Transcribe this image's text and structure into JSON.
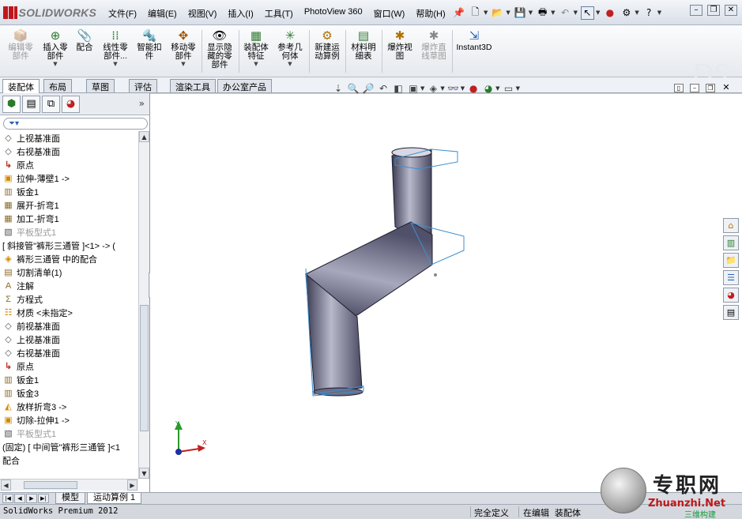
{
  "app": {
    "logo_text": "SOLIDWORKS"
  },
  "menu": [
    "文件(F)",
    "编辑(E)",
    "视图(V)",
    "插入(I)",
    "工具(T)",
    "PhotoView 360",
    "窗口(W)",
    "帮助(H)"
  ],
  "commands": [
    {
      "label": "编辑零\n部件",
      "icon": "edit-component-icon",
      "disabled": true,
      "arrow": false
    },
    {
      "label": "插入零\n部件",
      "icon": "insert-components-icon",
      "disabled": false,
      "arrow": true
    },
    {
      "label": "配合",
      "icon": "mate-icon",
      "disabled": false,
      "arrow": false
    },
    {
      "label": "线性零\n部件...",
      "icon": "linear-pattern-icon",
      "disabled": false,
      "arrow": true
    },
    {
      "label": "智能扣\n件",
      "icon": "smart-fasteners-icon",
      "disabled": false,
      "arrow": false
    },
    {
      "label": "移动零\n部件",
      "icon": "move-component-icon",
      "disabled": false,
      "arrow": true
    },
    {
      "label": "显示隐\n藏的零\n部件",
      "icon": "show-hidden-icon",
      "disabled": false,
      "arrow": false
    },
    {
      "label": "装配体\n特征",
      "icon": "assembly-features-icon",
      "disabled": false,
      "arrow": true
    },
    {
      "label": "参考几\n何体",
      "icon": "reference-geometry-icon",
      "disabled": false,
      "arrow": true
    },
    {
      "label": "新建运\n动算例",
      "icon": "new-motion-study-icon",
      "disabled": false,
      "arrow": false
    },
    {
      "label": "材料明\n细表",
      "icon": "bill-of-materials-icon",
      "disabled": false,
      "arrow": false
    },
    {
      "label": "爆炸视\n图",
      "icon": "exploded-view-icon",
      "disabled": false,
      "arrow": false
    },
    {
      "label": "爆炸直\n线草图",
      "icon": "explode-line-sketch-icon",
      "disabled": true,
      "arrow": false
    },
    {
      "label": "Instant3D",
      "icon": "instant3d-icon",
      "disabled": false,
      "arrow": false
    }
  ],
  "cm_tabs": [
    "装配体",
    "布局",
    "草图",
    "评估",
    "渲染工具",
    "办公室产品"
  ],
  "tree": [
    {
      "text": "上视基准面",
      "icon": "plane-icon",
      "dim": false
    },
    {
      "text": "右视基准面",
      "icon": "plane-icon",
      "dim": false
    },
    {
      "text": "原点",
      "icon": "origin-icon",
      "dim": false
    },
    {
      "text": "拉伸-薄壁1 ->",
      "icon": "extrude-icon",
      "dim": false
    },
    {
      "text": "钣金1",
      "icon": "sheet-metal-icon",
      "dim": false
    },
    {
      "text": "展开-折弯1",
      "icon": "unfold-icon",
      "dim": false
    },
    {
      "text": "加工-折弯1",
      "icon": "process-bend-icon",
      "dim": false
    },
    {
      "text": "平板型式1",
      "icon": "flat-pattern-icon",
      "dim": true
    },
    {
      "text": "[ 斜接管\"裤形三通管 ]<1> -> (",
      "icon": "",
      "dim": false
    },
    {
      "text": "裤形三通管 中的配合",
      "icon": "mates-folder-icon",
      "dim": false
    },
    {
      "text": "切割清单(1)",
      "icon": "cut-list-icon",
      "dim": false
    },
    {
      "text": "注解",
      "icon": "annotations-icon",
      "dim": false
    },
    {
      "text": "方程式",
      "icon": "equations-icon",
      "dim": false
    },
    {
      "text": "材质 <未指定>",
      "icon": "material-icon",
      "dim": false
    },
    {
      "text": "前视基准面",
      "icon": "plane-icon",
      "dim": false
    },
    {
      "text": "上视基准面",
      "icon": "plane-icon",
      "dim": false
    },
    {
      "text": "右视基准面",
      "icon": "plane-icon",
      "dim": false
    },
    {
      "text": "原点",
      "icon": "origin-icon",
      "dim": false
    },
    {
      "text": "钣金1",
      "icon": "sheet-metal-icon",
      "dim": false
    },
    {
      "text": "钣金3",
      "icon": "sheet-metal-icon",
      "dim": false
    },
    {
      "text": "放样折弯3 ->",
      "icon": "lofted-bend-icon",
      "dim": false
    },
    {
      "text": "切除-拉伸1 ->",
      "icon": "cut-extrude-icon",
      "dim": false
    },
    {
      "text": "平板型式1",
      "icon": "flat-pattern-icon",
      "dim": true
    },
    {
      "text": "(固定) [ 中间管\"裤形三通管 ]<1",
      "icon": "",
      "dim": false
    },
    {
      "text": "配合",
      "icon": "",
      "dim": false
    }
  ],
  "bottom_tabs": [
    "模型",
    "运动算例 1"
  ],
  "status": {
    "product": "SolidWorks Premium 2012",
    "definition": "完全定义",
    "editing": "在编辑",
    "mode": "装配体"
  },
  "triad": {
    "x": "X",
    "y": "Y"
  },
  "watermark": {
    "title": "专职网",
    "url": "Zhuanzhi.Net",
    "sub": "三维构建"
  },
  "colors": {
    "accent": "#c0161b",
    "part_fill": "#5e5e78",
    "edge": "#3d8fd0"
  }
}
